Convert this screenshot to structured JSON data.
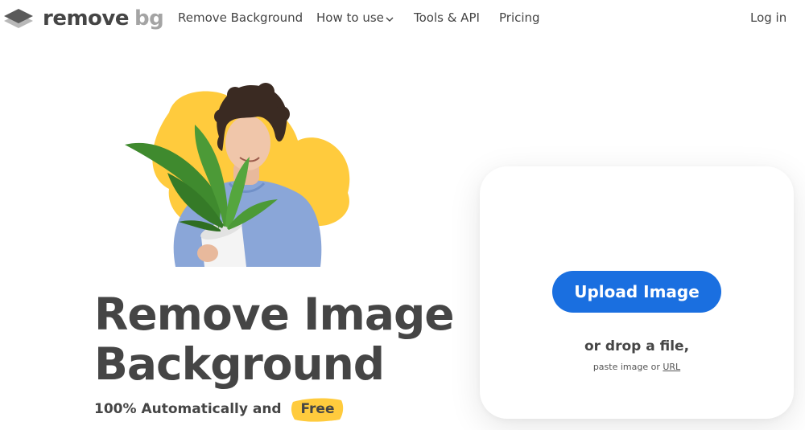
{
  "nav": {
    "logo_part1": "remove",
    "logo_part2": "bg",
    "items": [
      {
        "label": "Remove Background"
      },
      {
        "label": "How to use"
      },
      {
        "label": "Tools & API"
      },
      {
        "label": "Pricing"
      }
    ],
    "login": "Log in"
  },
  "hero": {
    "title_line1": "Remove Image",
    "title_line2": "Background",
    "subtitle": "100% Automatically and",
    "free_badge": "Free"
  },
  "upload": {
    "button_label": "Upload Image",
    "drop_text": "or drop a file,",
    "paste_prefix": "paste image or",
    "url_link": "URL"
  },
  "colors": {
    "primary_blue": "#1a6fe0",
    "accent_yellow": "#ffcb3d",
    "text_dark": "#454545",
    "logo_grey": "#a4a4a4"
  },
  "icons": [
    "logo-layers-icon",
    "chevron-down-icon"
  ]
}
